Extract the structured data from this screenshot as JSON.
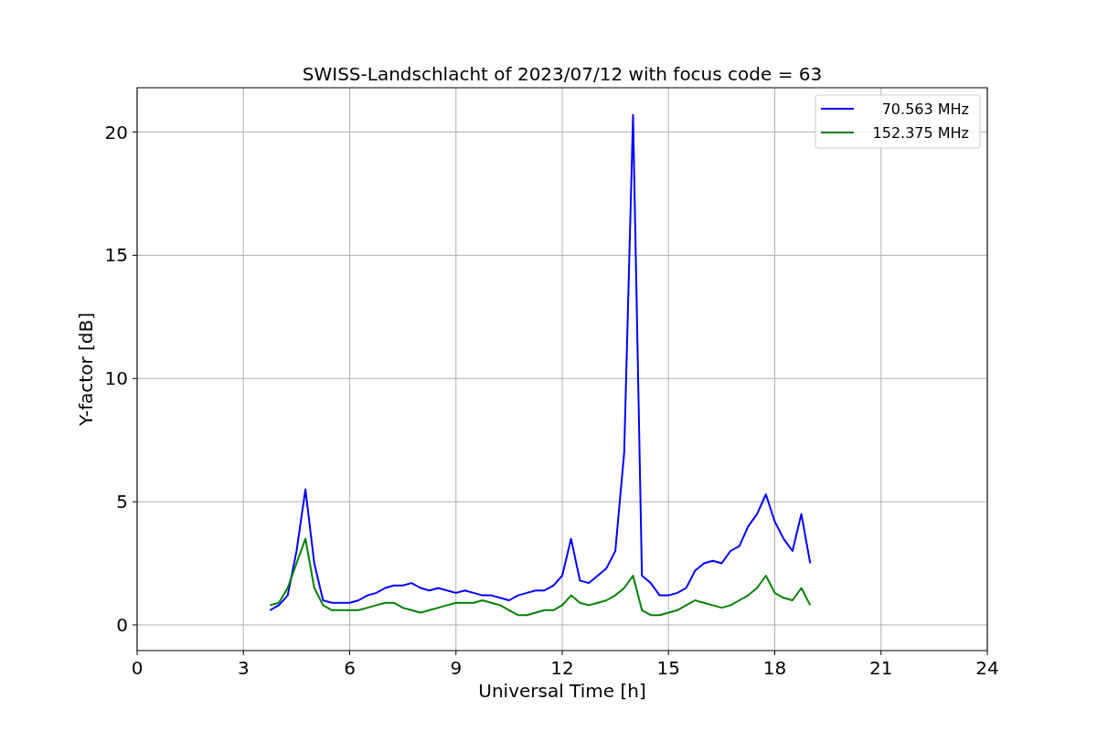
{
  "figure": {
    "chart_data": {
      "type": "line",
      "title": "SWISS-Landschlacht of 2023/07/12 with focus code = 63",
      "xlabel": "Universal Time [h]",
      "ylabel": "Y-factor [dB]",
      "x": [
        3.75,
        4,
        4.25,
        4.5,
        4.75,
        5,
        5.25,
        5.5,
        5.75,
        6,
        6.25,
        6.5,
        6.75,
        7,
        7.25,
        7.5,
        7.75,
        8,
        8.25,
        8.5,
        8.75,
        9,
        9.25,
        9.5,
        9.75,
        10,
        10.25,
        10.5,
        10.75,
        11,
        11.25,
        11.5,
        11.75,
        12,
        12.25,
        12.5,
        12.75,
        13,
        13.25,
        13.5,
        13.75,
        14,
        14.25,
        14.5,
        14.75,
        15,
        15.25,
        15.5,
        15.75,
        16,
        16.25,
        16.5,
        16.75,
        17,
        17.25,
        17.5,
        17.75,
        18,
        18.25,
        18.5,
        18.75,
        19
      ],
      "series": [
        {
          "name": "70.563 MHz",
          "color": "#0000ff",
          "values": [
            0.6,
            0.8,
            1.2,
            3.0,
            5.5,
            2.5,
            1.0,
            0.9,
            0.9,
            0.9,
            1.0,
            1.2,
            1.3,
            1.5,
            1.6,
            1.6,
            1.7,
            1.5,
            1.4,
            1.5,
            1.4,
            1.3,
            1.4,
            1.3,
            1.2,
            1.2,
            1.1,
            1.0,
            1.2,
            1.3,
            1.4,
            1.4,
            1.6,
            2.0,
            3.5,
            1.8,
            1.7,
            2.0,
            2.3,
            3.0,
            7.0,
            20.7,
            2.0,
            1.7,
            1.2,
            1.2,
            1.3,
            1.5,
            2.2,
            2.5,
            2.6,
            2.5,
            3.0,
            3.2,
            4.0,
            4.5,
            5.3,
            4.2,
            3.5,
            3.0,
            4.5,
            2.5
          ]
        },
        {
          "name": "152.375 MHz",
          "color": "#008000",
          "values": [
            0.8,
            0.9,
            1.5,
            2.5,
            3.5,
            1.5,
            0.8,
            0.6,
            0.6,
            0.6,
            0.6,
            0.7,
            0.8,
            0.9,
            0.9,
            0.7,
            0.6,
            0.5,
            0.6,
            0.7,
            0.8,
            0.9,
            0.9,
            0.9,
            1.0,
            0.9,
            0.8,
            0.6,
            0.4,
            0.4,
            0.5,
            0.6,
            0.6,
            0.8,
            1.2,
            0.9,
            0.8,
            0.9,
            1.0,
            1.2,
            1.5,
            2.0,
            0.6,
            0.4,
            0.4,
            0.5,
            0.6,
            0.8,
            1.0,
            0.9,
            0.8,
            0.7,
            0.8,
            1.0,
            1.2,
            1.5,
            2.0,
            1.3,
            1.1,
            1.0,
            1.5,
            0.8
          ]
        }
      ],
      "xlim": [
        0,
        24
      ],
      "ylim": [
        -1.04,
        21.8
      ],
      "xticks": [
        0,
        3,
        6,
        9,
        12,
        15,
        18,
        21,
        24
      ],
      "yticks": [
        0,
        5,
        10,
        15,
        20
      ],
      "grid": true,
      "legend": true
    }
  }
}
